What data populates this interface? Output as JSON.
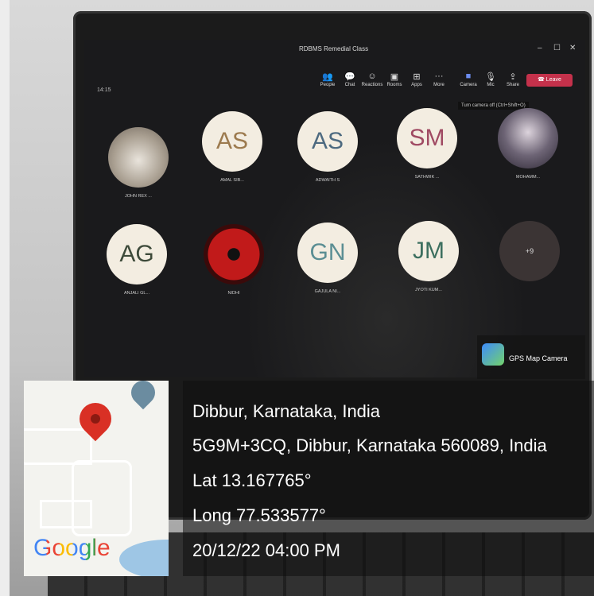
{
  "meeting": {
    "title": "RDBMS Remedial Class",
    "timer": "14:15",
    "min_symbol": "–",
    "max_symbol": "☐",
    "close_symbol": "✕"
  },
  "toolbar": {
    "items": [
      {
        "label": "People",
        "icon": "people-icon",
        "glyph": "👥"
      },
      {
        "label": "Chat",
        "icon": "chat-icon",
        "glyph": "💬"
      },
      {
        "label": "Reactions",
        "icon": "reactions-icon",
        "glyph": "☺"
      },
      {
        "label": "Rooms",
        "icon": "rooms-icon",
        "glyph": "▣"
      },
      {
        "label": "Apps",
        "icon": "apps-icon",
        "glyph": "⊞"
      },
      {
        "label": "More",
        "icon": "more-icon",
        "glyph": "···"
      }
    ],
    "camera_label": "Camera",
    "mic_label": "Mic",
    "share_label": "Share",
    "leave_label": "Leave",
    "tooltip": "Turn camera off (Ctrl+Shift+O)"
  },
  "participants": [
    {
      "initials": "",
      "name": "JOHN REX ...",
      "kind": "photo-cat"
    },
    {
      "initials": "AS",
      "name": "AMAL SIB...",
      "kind": "initials"
    },
    {
      "initials": "AS",
      "name": "ADWAITH S",
      "kind": "initials"
    },
    {
      "initials": "SM",
      "name": "SATHWIK ...",
      "kind": "initials"
    },
    {
      "initials": "",
      "name": "MOHAMM...",
      "kind": "photo-anime"
    },
    {
      "initials": "AG",
      "name": "ANJALI GL...",
      "kind": "initials"
    },
    {
      "initials": "",
      "name": "NIDHI",
      "kind": "photo-sharingan"
    },
    {
      "initials": "GN",
      "name": "GAJULA NI...",
      "kind": "initials"
    },
    {
      "initials": "JM",
      "name": "JYOTI KUM...",
      "kind": "initials"
    },
    {
      "initials": "+9",
      "name": "",
      "kind": "more"
    }
  ],
  "gps_badge": {
    "label": "GPS Map Camera"
  },
  "location": {
    "place": "Dibbur, Karnataka, India",
    "address": "5G9M+3CQ, Dibbur, Karnataka 560089, India",
    "lat": "Lat 13.167765°",
    "long": "Long 77.533577°",
    "datetime": "20/12/22 04:00 PM"
  },
  "map": {
    "logo": "Google",
    "logo_colors": [
      "#4285F4",
      "#EA4335",
      "#FBBC05",
      "#4285F4",
      "#34A853",
      "#EA4335"
    ]
  }
}
